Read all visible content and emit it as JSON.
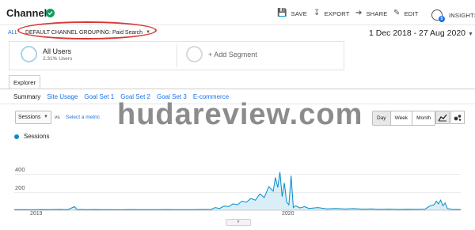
{
  "header": {
    "title": "Channels",
    "save_label": "SAVE",
    "export_label": "EXPORT",
    "share_label": "SHARE",
    "edit_label": "EDIT",
    "insights_label": "INSIGHTS",
    "insights_count": "5"
  },
  "filter": {
    "all_label": "ALL",
    "grouping_label": "DEFAULT CHANNEL GROUPING: Paid Search"
  },
  "date_range": "1 Dec 2018 - 27 Aug 2020",
  "segments": {
    "active_title": "All Users",
    "active_subtitle": "2.31% Users",
    "add_label": "+ Add Segment"
  },
  "tabs": {
    "explorer": "Explorer"
  },
  "subtabs": [
    "Summary",
    "Site Usage",
    "Goal Set 1",
    "Goal Set 2",
    "Goal Set 3",
    "E-commerce"
  ],
  "metric": {
    "selected": "Sessions",
    "vs_label": "vs",
    "select_label": "Select a metric"
  },
  "granularity": [
    "Day",
    "Week",
    "Month"
  ],
  "watermark": "hudareview.com",
  "chart_data": {
    "type": "area",
    "series": [
      {
        "name": "Sessions",
        "color": "#058dc7"
      }
    ],
    "y_ticks": [
      "400",
      "200"
    ],
    "x_ticks": [
      "2019",
      "2020"
    ],
    "ylim": [
      0,
      450
    ],
    "points": [
      [
        0,
        6
      ],
      [
        0.02,
        7
      ],
      [
        0.04,
        5
      ],
      [
        0.06,
        8
      ],
      [
        0.08,
        6
      ],
      [
        0.1,
        9
      ],
      [
        0.12,
        7
      ],
      [
        0.135,
        40
      ],
      [
        0.14,
        10
      ],
      [
        0.16,
        6
      ],
      [
        0.18,
        8
      ],
      [
        0.2,
        6
      ],
      [
        0.22,
        7
      ],
      [
        0.24,
        5
      ],
      [
        0.26,
        8
      ],
      [
        0.28,
        6
      ],
      [
        0.3,
        7
      ],
      [
        0.32,
        6
      ],
      [
        0.34,
        8
      ],
      [
        0.36,
        6
      ],
      [
        0.38,
        7
      ],
      [
        0.4,
        6
      ],
      [
        0.42,
        9
      ],
      [
        0.44,
        8
      ],
      [
        0.45,
        30
      ],
      [
        0.46,
        20
      ],
      [
        0.47,
        45
      ],
      [
        0.48,
        40
      ],
      [
        0.49,
        70
      ],
      [
        0.5,
        60
      ],
      [
        0.51,
        100
      ],
      [
        0.52,
        90
      ],
      [
        0.53,
        130
      ],
      [
        0.54,
        110
      ],
      [
        0.55,
        180
      ],
      [
        0.56,
        140
      ],
      [
        0.57,
        260
      ],
      [
        0.58,
        210
      ],
      [
        0.585,
        360
      ],
      [
        0.59,
        250
      ],
      [
        0.595,
        420
      ],
      [
        0.6,
        150
      ],
      [
        0.605,
        300
      ],
      [
        0.61,
        90
      ],
      [
        0.615,
        60
      ],
      [
        0.62,
        380
      ],
      [
        0.625,
        30
      ],
      [
        0.63,
        50
      ],
      [
        0.64,
        25
      ],
      [
        0.65,
        40
      ],
      [
        0.66,
        20
      ],
      [
        0.68,
        30
      ],
      [
        0.7,
        15
      ],
      [
        0.72,
        20
      ],
      [
        0.74,
        14
      ],
      [
        0.76,
        18
      ],
      [
        0.78,
        12
      ],
      [
        0.8,
        14
      ],
      [
        0.82,
        10
      ],
      [
        0.84,
        12
      ],
      [
        0.86,
        9
      ],
      [
        0.88,
        11
      ],
      [
        0.9,
        10
      ],
      [
        0.92,
        12
      ],
      [
        0.93,
        45
      ],
      [
        0.94,
        60
      ],
      [
        0.945,
        100
      ],
      [
        0.95,
        70
      ],
      [
        0.955,
        110
      ],
      [
        0.96,
        50
      ],
      [
        0.965,
        80
      ],
      [
        0.97,
        20
      ],
      [
        0.98,
        10
      ],
      [
        1,
        8
      ]
    ]
  }
}
